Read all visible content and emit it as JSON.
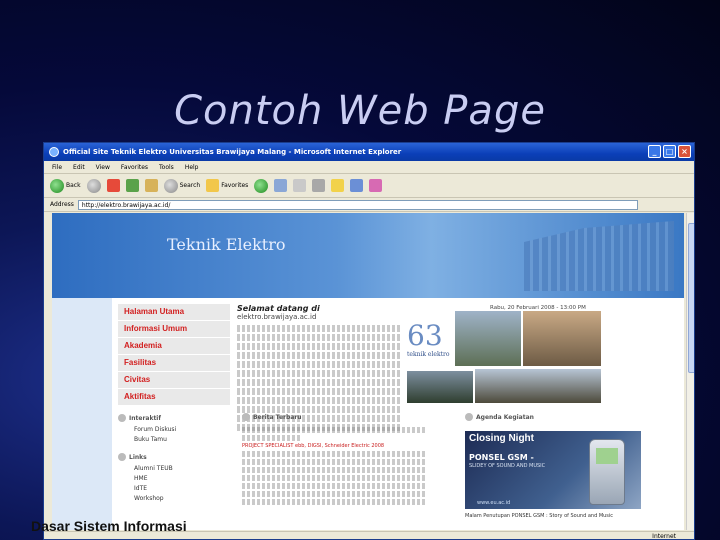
{
  "slide": {
    "title": "Contoh Web Page",
    "footer": "Dasar Sistem Informasi"
  },
  "window": {
    "title": "Official Site Teknik Elektro Universitas Brawijaya Malang - Microsoft Internet Explorer",
    "minimize": "_",
    "maximize": "□",
    "close": "×"
  },
  "menu": [
    "File",
    "Edit",
    "View",
    "Favorites",
    "Tools",
    "Help"
  ],
  "toolbar": {
    "back": "Back",
    "search": "Search",
    "favorites": "Favorites"
  },
  "address": {
    "label": "Address",
    "value": "http://elektro.brawijaya.ac.id/"
  },
  "site": {
    "banner_title": "Teknik Elektro",
    "nav": [
      "Halaman Utama",
      "Informasi Umum",
      "Akademia",
      "Fasilitas",
      "Civitas",
      "Aktifitas"
    ],
    "interaktif_head": "Interaktif",
    "interaktif_links": [
      "Forum Diskusi",
      "Buku Tamu"
    ],
    "links_head": "Links",
    "links": [
      "Alumni TEUB",
      "HME",
      "IdTE",
      "Workshop"
    ],
    "welcome": "Selamat datang di",
    "domain": "elektro.brawijaya.ac.id",
    "date": "Rabu, 20 Februari 2008 - 13:00 PM",
    "anniv_number": "63",
    "anniv_sub": "teknik elektro",
    "berita_head": "Berita Terbaru",
    "news_item": "PROJECT SPECIALIST ebb, DIGSI, Schneider Electric 2008",
    "agenda_head": "Agenda Kegiatan",
    "promo_title": "Closing Night",
    "promo_sub": "PONSEL GSM -",
    "promo_sub2": "SLIDEY OF SOUND AND MUSIC",
    "promo_web": "www.eu.ac.id",
    "promo_caption": "Malam Penutupan PONSEL GSM : Story of Sound and Music"
  },
  "status": {
    "zone": "Internet"
  }
}
